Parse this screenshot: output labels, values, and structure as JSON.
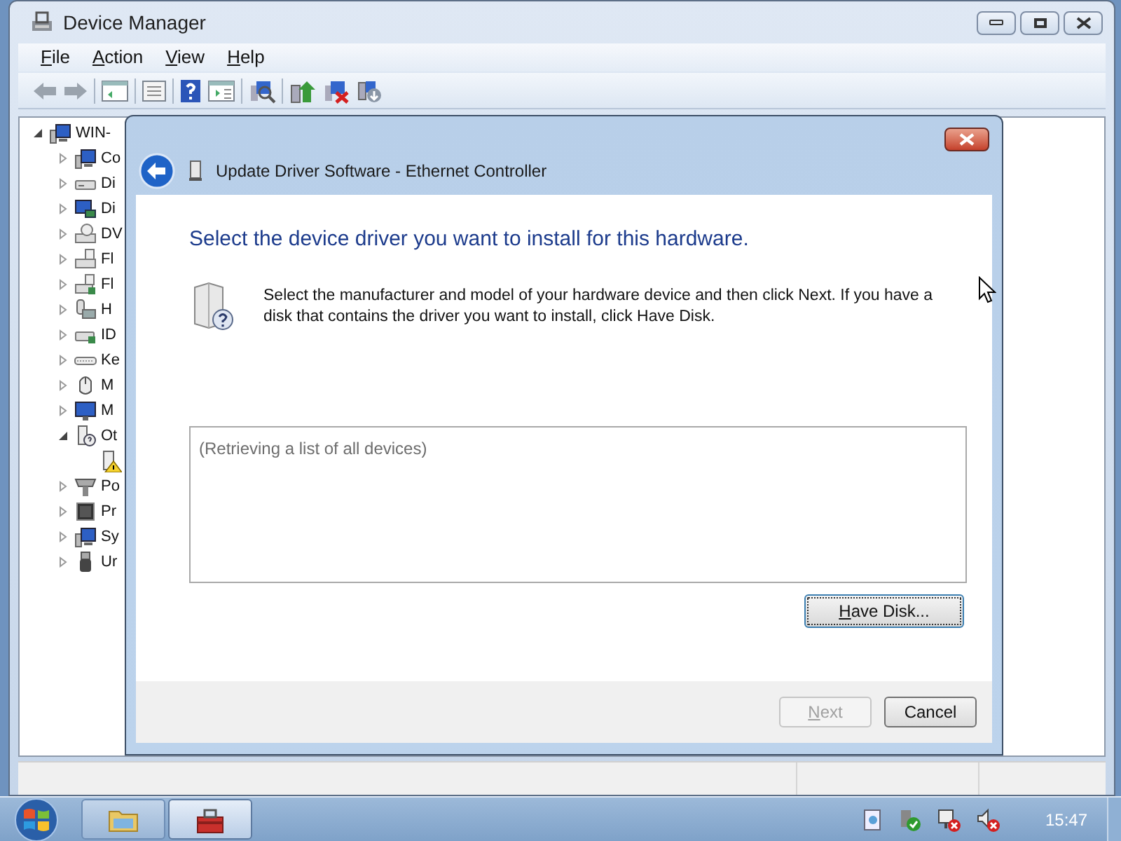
{
  "window": {
    "title": "Device Manager"
  },
  "menu": [
    {
      "label": "File"
    },
    {
      "label": "Action"
    },
    {
      "label": "View"
    },
    {
      "label": "Help"
    }
  ],
  "tree": [
    {
      "label": "WIN-",
      "expanded": true,
      "children": [
        {
          "label": "Co",
          "kind": "computer",
          "expanded": false
        },
        {
          "label": "Di",
          "kind": "drive",
          "expanded": false
        },
        {
          "label": "Di",
          "kind": "display",
          "expanded": false
        },
        {
          "label": "DV",
          "kind": "dvd",
          "expanded": false
        },
        {
          "label": "Fl",
          "kind": "floppy",
          "expanded": false
        },
        {
          "label": "Fl",
          "kind": "floppy-controller",
          "expanded": false
        },
        {
          "label": "H",
          "kind": "hid",
          "expanded": false
        },
        {
          "label": "ID",
          "kind": "ide",
          "expanded": false
        },
        {
          "label": "Ke",
          "kind": "keyboard",
          "expanded": false
        },
        {
          "label": "M",
          "kind": "mouse",
          "expanded": false
        },
        {
          "label": "M",
          "kind": "monitor",
          "expanded": false
        },
        {
          "label": "Ot",
          "kind": "other",
          "expanded": true,
          "children": [
            {
              "kind": "unknown",
              "warning": true
            }
          ]
        },
        {
          "label": "Po",
          "kind": "port",
          "expanded": false
        },
        {
          "label": "Pr",
          "kind": "processor",
          "expanded": false
        },
        {
          "label": "Sy",
          "kind": "computer",
          "expanded": false
        },
        {
          "label": "Ur",
          "kind": "usb",
          "expanded": false
        }
      ]
    }
  ],
  "dialog": {
    "title": "Update Driver Software - Ethernet Controller",
    "heading": "Select the device driver you want to install for this hardware.",
    "description": "Select the manufacturer and model of your hardware device and then click Next. If you have a disk that contains the driver you want to install, click Have Disk.",
    "list_box": {
      "placeholder": "(Retrieving a list of all devices)"
    },
    "have_disk": {
      "label": "Have Disk...",
      "focused": true,
      "disabled": false
    },
    "buttons": [
      {
        "label": "Next",
        "disabled": true
      },
      {
        "label": "Cancel",
        "disabled": false
      }
    ]
  },
  "taskbar": {
    "tasks": [
      {
        "kind": "explorer",
        "selected": false
      },
      {
        "kind": "device-manager",
        "selected": true
      }
    ],
    "clock": "15:47"
  }
}
